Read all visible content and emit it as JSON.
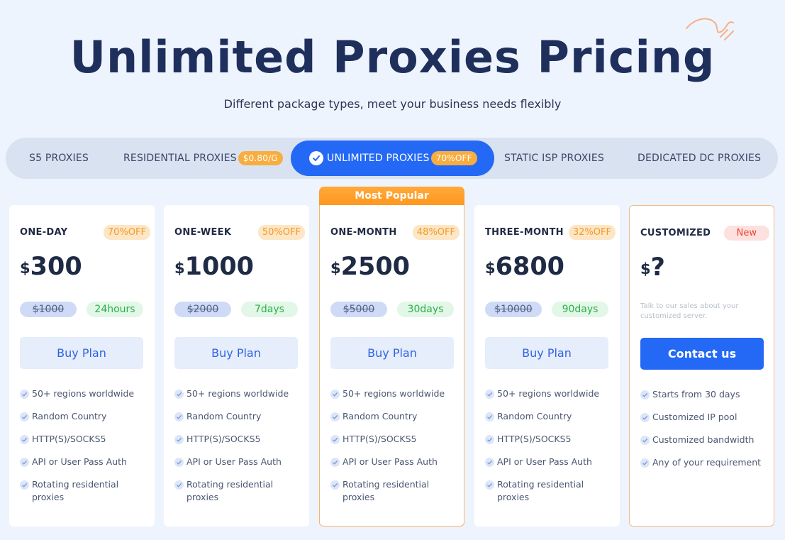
{
  "header": {
    "title": "Unlimited Proxies Pricing",
    "subtitle": "Different package types, meet your business needs flexibly"
  },
  "tabs": [
    {
      "label": "S5 PROXIES",
      "badge": ""
    },
    {
      "label": "RESIDENTIAL PROXIES",
      "badge": "$0.80/G"
    },
    {
      "label": "UNLIMITED PROXIES",
      "badge": "70%OFF",
      "active": true
    },
    {
      "label": "STATIC ISP PROXIES",
      "badge": ""
    },
    {
      "label": "DEDICATED DC PROXIES",
      "badge": ""
    }
  ],
  "popular_label": "Most Popular",
  "plans": [
    {
      "name": "ONE-DAY",
      "discount": "70%OFF",
      "currency": "$",
      "price": "300",
      "original": "$1000",
      "duration": "24hours",
      "button": "Buy Plan",
      "features": [
        "50+ regions worldwide",
        "Random Country",
        "HTTP(S)/SOCKS5",
        "API or User Pass Auth",
        "Rotating residential proxies"
      ]
    },
    {
      "name": "ONE-WEEK",
      "discount": "50%OFF",
      "currency": "$",
      "price": "1000",
      "original": "$2000",
      "duration": "7days",
      "button": "Buy Plan",
      "features": [
        "50+ regions worldwide",
        "Random Country",
        "HTTP(S)/SOCKS5",
        "API or User Pass Auth",
        "Rotating residential proxies"
      ]
    },
    {
      "name": "ONE-MONTH",
      "discount": "48%OFF",
      "currency": "$",
      "price": "2500",
      "original": "$5000",
      "duration": "30days",
      "button": "Buy Plan",
      "features": [
        "50+ regions worldwide",
        "Random Country",
        "HTTP(S)/SOCKS5",
        "API or User Pass Auth",
        "Rotating residential proxies"
      ]
    },
    {
      "name": "THREE-MONTH",
      "discount": "32%OFF",
      "currency": "$",
      "price": "6800",
      "original": "$10000",
      "duration": "90days",
      "button": "Buy Plan",
      "features": [
        "50+ regions worldwide",
        "Random Country",
        "HTTP(S)/SOCKS5",
        "API or User Pass Auth",
        "Rotating residential proxies"
      ]
    },
    {
      "name": "CUSTOMIZED",
      "discount": "New",
      "currency": "$",
      "price": "?",
      "note": "Talk to our sales about your customized server.",
      "button": "Contact us",
      "features": [
        "Starts from 30 days",
        "Customized IP pool",
        "Customized bandwidth",
        "Any of your requirement"
      ]
    }
  ],
  "colors": {
    "accent": "#2469f6",
    "popular": "#ff9a22",
    "background": "#eef4fd"
  }
}
